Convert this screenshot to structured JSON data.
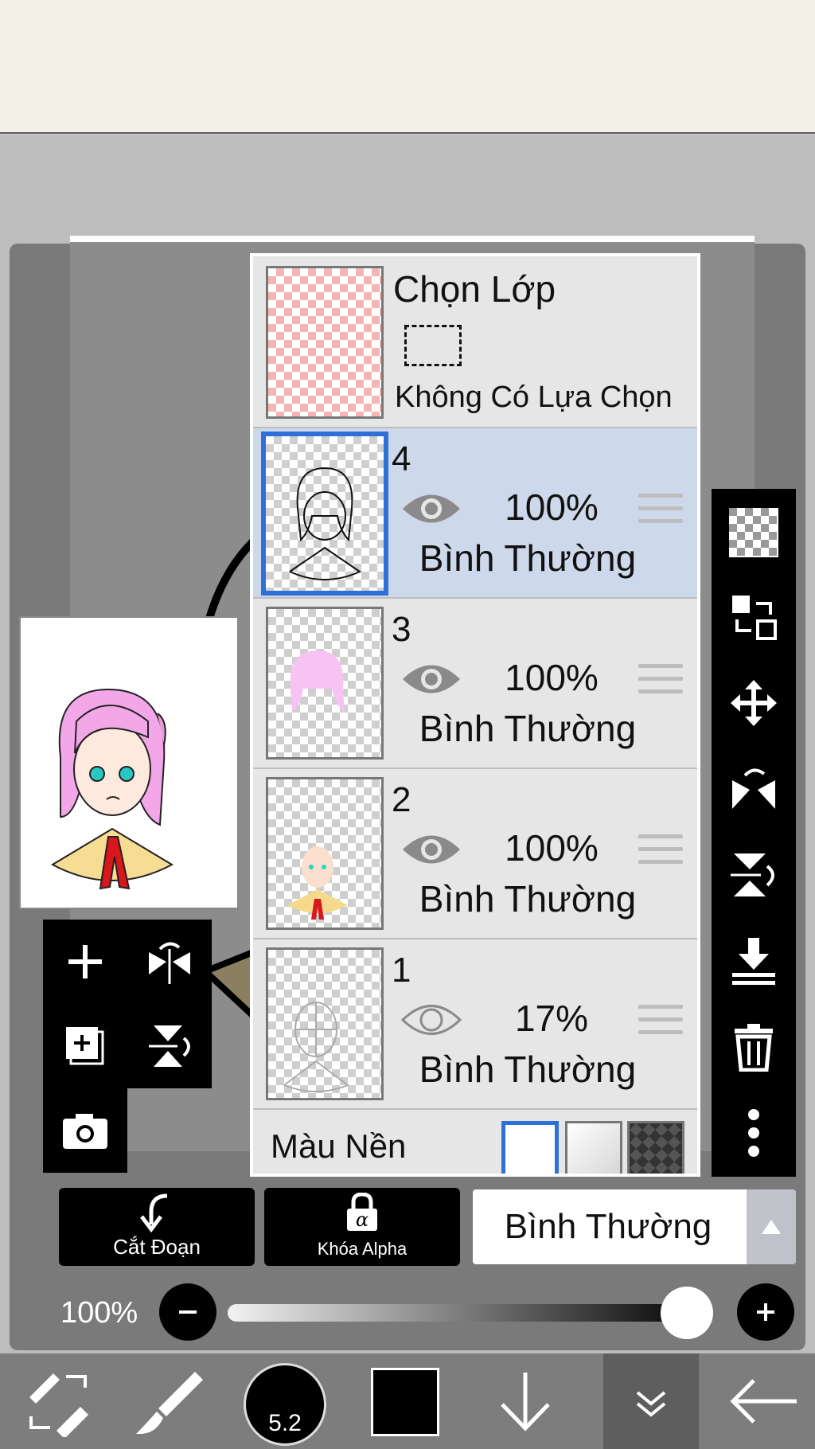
{
  "layer_panel": {
    "selection": {
      "title": "Chọn Lớp",
      "subtitle": "Không Có Lựa Chọn"
    },
    "layers": [
      {
        "number": "4",
        "opacity": "100%",
        "blend_mode": "Bình Thường",
        "visible": true,
        "active": true
      },
      {
        "number": "3",
        "opacity": "100%",
        "blend_mode": "Bình Thường",
        "visible": true,
        "active": false
      },
      {
        "number": "2",
        "opacity": "100%",
        "blend_mode": "Bình Thường",
        "visible": true,
        "active": false
      },
      {
        "number": "1",
        "opacity": "17%",
        "blend_mode": "Bình Thường",
        "visible": false,
        "active": false
      }
    ],
    "background": {
      "label": "Màu Nền",
      "swatches": [
        "white",
        "transparent",
        "dark"
      ]
    }
  },
  "actions": {
    "clipping_label": "Cắt Đoạn",
    "alpha_lock_label": "Khóa Alpha",
    "blend_mode_value": "Bình Thường"
  },
  "opacity_slider": {
    "label": "100%",
    "value": 1.0
  },
  "bottom_toolbar": {
    "brush_size": "5.2",
    "color": "#000000"
  },
  "colors": {
    "active_layer_bg": "#cdd8ea",
    "active_border": "#2f6fd8",
    "panel_bg": "#e6e6e6"
  }
}
